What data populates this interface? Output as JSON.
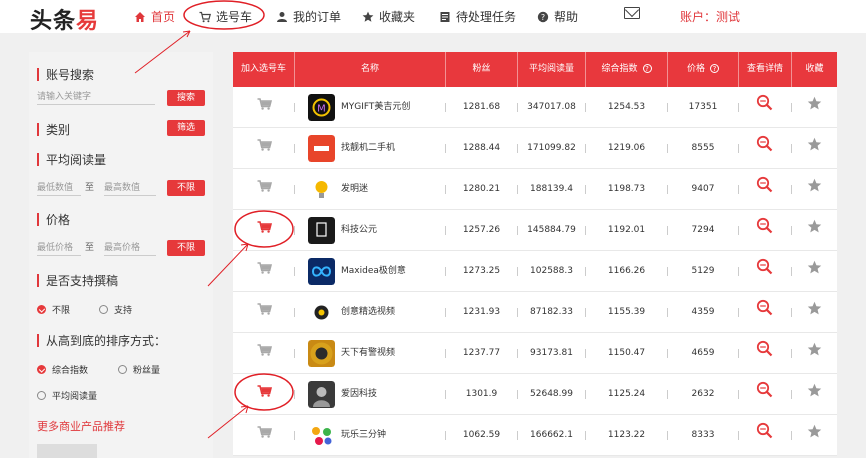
{
  "header": {
    "logo": "头条易",
    "nav": [
      {
        "label": "首页",
        "icon": "home-icon"
      },
      {
        "label": "选号车",
        "icon": "cart-icon"
      },
      {
        "label": "我的订单",
        "icon": "person-icon"
      },
      {
        "label": "收藏夹",
        "icon": "star-icon"
      },
      {
        "label": "待处理任务",
        "icon": "task-icon"
      },
      {
        "label": "帮助",
        "icon": "help-icon"
      }
    ],
    "account": "账户：测试"
  },
  "sidebar": {
    "account_search": {
      "title": "账号搜索",
      "placeholder": "请输入关键字",
      "button": "搜索"
    },
    "category": {
      "title": "类别",
      "button": "筛选"
    },
    "avg_read": {
      "title": "平均阅读量",
      "min_placeholder": "最低数值",
      "to": "至",
      "max_placeholder": "最高数值",
      "button": "不限"
    },
    "price": {
      "title": "价格",
      "min_placeholder": "最低价格",
      "to": "至",
      "max_placeholder": "最高价格",
      "button": "不限"
    },
    "manuscript": {
      "title": "是否支持撰稿",
      "options": [
        {
          "label": "不限",
          "checked": true
        },
        {
          "label": "支持",
          "checked": false
        }
      ]
    },
    "sort": {
      "title": "从高到底的排序方式：",
      "options": [
        {
          "label": "综合指数",
          "checked": true
        },
        {
          "label": "粉丝量",
          "checked": false
        },
        {
          "label": "平均阅读量",
          "checked": false
        }
      ]
    },
    "promo": "更多商业产品推荐"
  },
  "table": {
    "headers": [
      "加入选号车",
      "名称",
      "粉丝",
      "平均阅读量",
      "综合指数",
      "价格",
      "查看详情",
      "收藏"
    ],
    "help_mark": "?",
    "rows": [
      {
        "name": "MYGIFT美吉元创",
        "fans": "1281.68",
        "avg_read": "347017.08",
        "index": "1254.53",
        "price": "17351",
        "cart_active": false
      },
      {
        "name": "找靓机二手机",
        "fans": "1288.44",
        "avg_read": "171099.82",
        "index": "1219.06",
        "price": "8555",
        "cart_active": false
      },
      {
        "name": "发明迷",
        "fans": "1280.21",
        "avg_read": "188139.4",
        "index": "1198.73",
        "price": "9407",
        "cart_active": false
      },
      {
        "name": "科技公元",
        "fans": "1257.26",
        "avg_read": "145884.79",
        "index": "1192.01",
        "price": "7294",
        "cart_active": true
      },
      {
        "name": "Maxidea极创意",
        "fans": "1273.25",
        "avg_read": "102588.3",
        "index": "1166.26",
        "price": "5129",
        "cart_active": false
      },
      {
        "name": "创意精选视频",
        "fans": "1231.93",
        "avg_read": "87182.33",
        "index": "1155.39",
        "price": "4359",
        "cart_active": false
      },
      {
        "name": "天下有警视频",
        "fans": "1237.77",
        "avg_read": "93173.81",
        "index": "1150.47",
        "price": "4659",
        "cart_active": false
      },
      {
        "name": "爱因科技",
        "fans": "1301.9",
        "avg_read": "52648.99",
        "index": "1125.24",
        "price": "2632",
        "cart_active": true
      },
      {
        "name": "玩乐三分钟",
        "fans": "1062.59",
        "avg_read": "166662.1",
        "index": "1123.22",
        "price": "8333",
        "cart_active": false
      }
    ]
  },
  "colors": {
    "accent": "#e6393b",
    "header_bg": "#e8383d",
    "cart_inactive": "#a9a9a9",
    "icon_grey": "#9a9a9a"
  }
}
